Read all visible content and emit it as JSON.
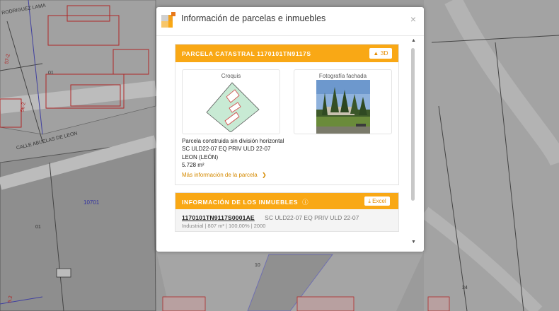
{
  "map": {
    "street_label_top": "RODRIGUEZ LAMA",
    "street_label_mid": "CALLE ABUELAS DE LEON",
    "parcel_ids": [
      "01",
      "01",
      "10701"
    ],
    "labels_red": [
      "57-2",
      "56-2",
      "5.2"
    ],
    "labels_misc": [
      "34",
      "10"
    ]
  },
  "modal": {
    "title": "Información de parcelas e inmuebles",
    "close": "×",
    "parcel_card": {
      "header": "PARCELA CATASTRAL 1170101TN9117S",
      "btn_3d": "3D",
      "croquis_label": "Croquis",
      "fachada_label": "Fotografía fachada",
      "line1": "Parcela construida sin división horizontal",
      "line2": "SC ULD22-07 EQ PRIV ULD 22-07",
      "line3": "LEON (LEÓN)",
      "area": "5.728 m²",
      "more_link": "Más información de la parcela"
    },
    "inmuebles_card": {
      "header": "INFORMACIÓN DE LOS INMUEBLES",
      "btn_excel": "Excel",
      "ref": "1170101TN9117S0001AE",
      "address": "SC ULD22-07 EQ PRIV ULD 22-07",
      "details": "Industrial | 807 m² | 100,00% | 2000"
    }
  }
}
